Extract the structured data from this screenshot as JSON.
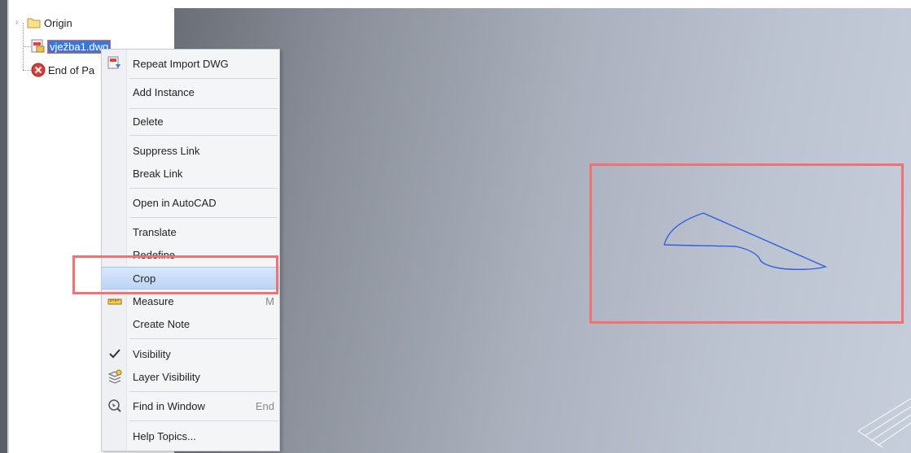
{
  "tree": {
    "items": [
      {
        "label": "Origin",
        "icon": "folder-icon"
      },
      {
        "label": "vježba1.dwg",
        "icon": "dwg-file-icon",
        "selected": true
      },
      {
        "label": "End of Pa",
        "icon": "end-of-part-icon"
      }
    ]
  },
  "context_menu": {
    "items": [
      {
        "id": "repeat-import",
        "label": "Repeat Import DWG",
        "icon": "import-dwg-icon"
      },
      {
        "id": "add-instance",
        "label": "Add Instance"
      },
      {
        "id": "delete",
        "label": "Delete"
      },
      {
        "id": "suppress-link",
        "label": "Suppress Link"
      },
      {
        "id": "break-link",
        "label": "Break Link"
      },
      {
        "id": "open-autocad",
        "label": "Open in AutoCAD"
      },
      {
        "id": "translate",
        "label": "Translate"
      },
      {
        "id": "redefine",
        "label": "Redefine"
      },
      {
        "id": "crop",
        "label": "Crop",
        "hover": true
      },
      {
        "id": "measure",
        "label": "Measure",
        "icon": "ruler-icon",
        "shortcut": "M"
      },
      {
        "id": "create-note",
        "label": "Create Note"
      },
      {
        "id": "visibility",
        "label": "Visibility",
        "icon": "checkmark-icon",
        "checked": true
      },
      {
        "id": "layer-visibility",
        "label": "Layer Visibility",
        "icon": "layers-icon"
      },
      {
        "id": "find-window",
        "label": "Find in Window",
        "icon": "find-magnifier-icon",
        "shortcut": "End"
      },
      {
        "id": "help-topics",
        "label": "Help Topics..."
      }
    ]
  },
  "colors": {
    "selection": "#3a78d8",
    "annotation": "#ef7373",
    "sketch_line": "#2f5fe0"
  }
}
